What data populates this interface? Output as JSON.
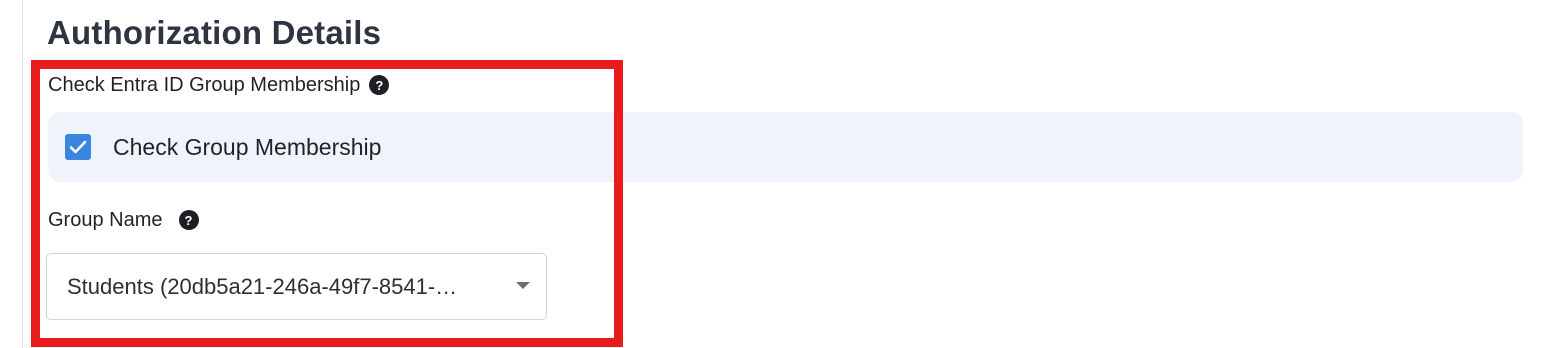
{
  "section": {
    "title": "Authorization Details"
  },
  "group_membership": {
    "label": "Check Entra ID Group Membership",
    "help_glyph": "?",
    "checkbox": {
      "label": "Check Group Membership",
      "checked": true,
      "color": "#3a86df"
    }
  },
  "group_name": {
    "label": "Group Name",
    "help_glyph": "?",
    "selected_value": "Students (20db5a21-246a-49f7-8541-…"
  },
  "annotation": {
    "highlight_color": "#e81c1c"
  }
}
